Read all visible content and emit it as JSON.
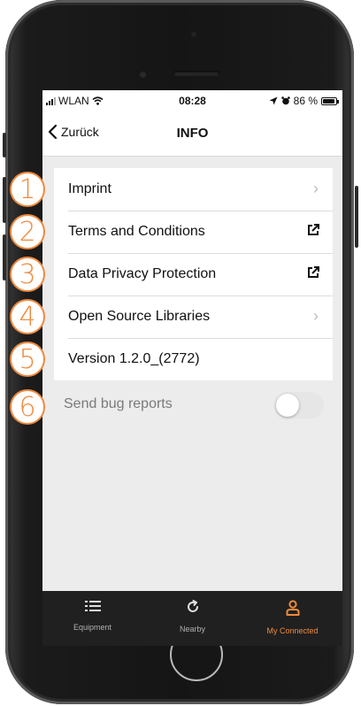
{
  "status_bar": {
    "carrier": "WLAN",
    "time": "08:28",
    "battery": "86 %"
  },
  "nav": {
    "back_label": "Zurück",
    "title": "INFO"
  },
  "menu": [
    {
      "label": "Imprint",
      "accessory": "chevron"
    },
    {
      "label": "Terms and Conditions",
      "accessory": "external-link"
    },
    {
      "label": "Data Privacy Protection",
      "accessory": "external-link"
    },
    {
      "label": "Open Source Libraries",
      "accessory": "chevron"
    },
    {
      "label": "Version 1.2.0_(2772)",
      "accessory": "none"
    }
  ],
  "bug_reports": {
    "label": "Send bug reports",
    "enabled": false
  },
  "badges": [
    "1",
    "2",
    "3",
    "4",
    "5",
    "6"
  ],
  "tabs": [
    {
      "label": "Equipment",
      "icon": "list-icon",
      "active": false
    },
    {
      "label": "Nearby",
      "icon": "refresh-icon",
      "active": false
    },
    {
      "label": "My Connected",
      "icon": "person-icon",
      "active": true
    }
  ],
  "colors": {
    "accent": "#ee8a3e",
    "tabbar": "#202020",
    "background": "#ececec"
  }
}
